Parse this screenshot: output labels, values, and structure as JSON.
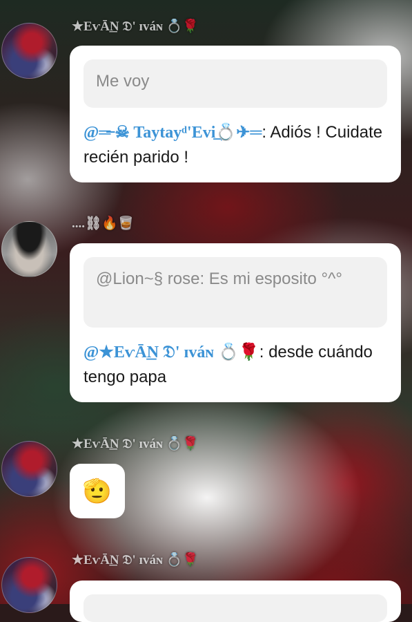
{
  "messages": [
    {
      "sender": "★EѵĀ͟N 𝔇' ɪᴠáɴ 💍🌹",
      "quote": "Me voy",
      "reply_mention": "@═̶̶̶̶ ☠ Taytayᵈ'Evi͢͢͢💍✈═",
      "reply_text": ": Adiós ! Cuidate recién parido !"
    },
    {
      "sender": "....⛓🔥🥃",
      "quote": "@Lion~§ rose: Es mi esposito °^°",
      "reply_mention": "@★EѵĀ͟N 𝔇' ɪᴠáɴ 💍🌹",
      "reply_text": ": desde cuándo tengo papa"
    },
    {
      "sender": "★EѵĀ͟N 𝔇' ɪᴠáɴ 💍🌹",
      "sticker": "🫡"
    },
    {
      "sender": "★EѵĀ͟N 𝔇' ɪᴠáɴ 💍🌹"
    }
  ]
}
